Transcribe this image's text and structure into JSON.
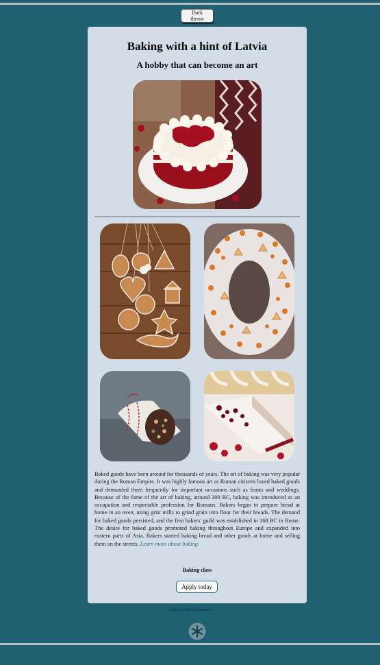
{
  "theme_toggle": {
    "label": "Dark theme"
  },
  "header": {
    "title": "Baking with a hint of Latvia",
    "subtitle": "A hobby that can become an art"
  },
  "images": {
    "hero": "red-velvet-cake-latvia-map",
    "gallery": [
      "gingerbread-cookies",
      "meringue-wreath-cake",
      "chocolate-salami-roll",
      "cream-cake-with-berries"
    ]
  },
  "article": {
    "text": "Baked goods have been around for thousands of years. The art of baking was very popular during the Roman Empire. It was highly famous art as Roman citizens loved baked goods and demanded them frequently for important occasions such as feasts and weddings. Because of the fame of the art of baking, around 300 BC, baking was introduced as an occupation and respectable profession for Romans. Bakers began to prepare bread at home in an oven, using grist mills to grind grain into flour for their breads. The demand for baked goods persisted, and the first bakers' guild was established in 168 BC in Rome. The desire for baked goods promoted baking throughout Europe and expanded into eastern parts of Asia. Bakers started baking bread and other goods at home and selling them on the streets.",
    "link_label": "Learn more about baking."
  },
  "cta": {
    "heading": "Baking class",
    "button_label": "Apply today"
  },
  "footer": {
    "credit": "Coded by Ruta Baumane",
    "logo_icon": "snowflake-icon"
  },
  "colors": {
    "background": "#1f6172",
    "card": "#d3dde8",
    "accent": "#2c6576"
  }
}
